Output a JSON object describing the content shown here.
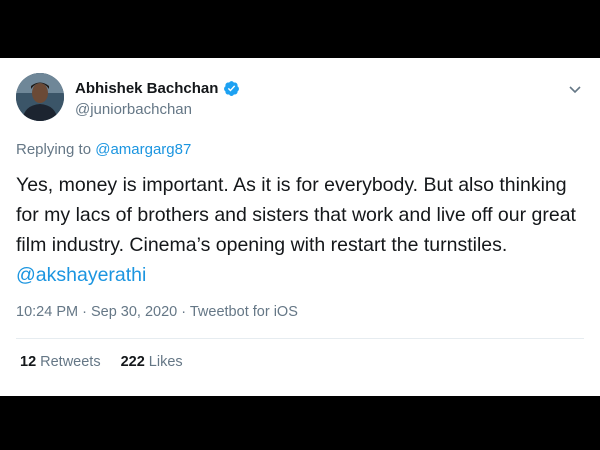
{
  "user": {
    "name": "Abhishek Bachchan",
    "handle": "@juniorbachchan"
  },
  "reply": {
    "prefix": "Replying to",
    "to": "@amargarg87"
  },
  "tweet": {
    "text": "Yes, money is important. As it is for everybody. But also thinking for my lacs of brothers and sisters that work and live off our great film industry. Cinema’s opening with restart the turnstiles.",
    "mention": "@akshayerathi"
  },
  "meta": {
    "time": "10:24 PM",
    "separator1": " · ",
    "date": "Sep 30, 2020",
    "separator2": " · ",
    "client": "Tweetbot for iOS"
  },
  "stats": {
    "retweets_count": "12",
    "retweets_label": "Retweets",
    "likes_count": "222",
    "likes_label": "Likes"
  },
  "colors": {
    "link": "#1b95e0",
    "verified": "#1da1f2",
    "muted": "#657786",
    "text": "#14171a"
  },
  "icons": {
    "verified": "verified-badge-icon",
    "caret": "chevron-down-icon"
  }
}
